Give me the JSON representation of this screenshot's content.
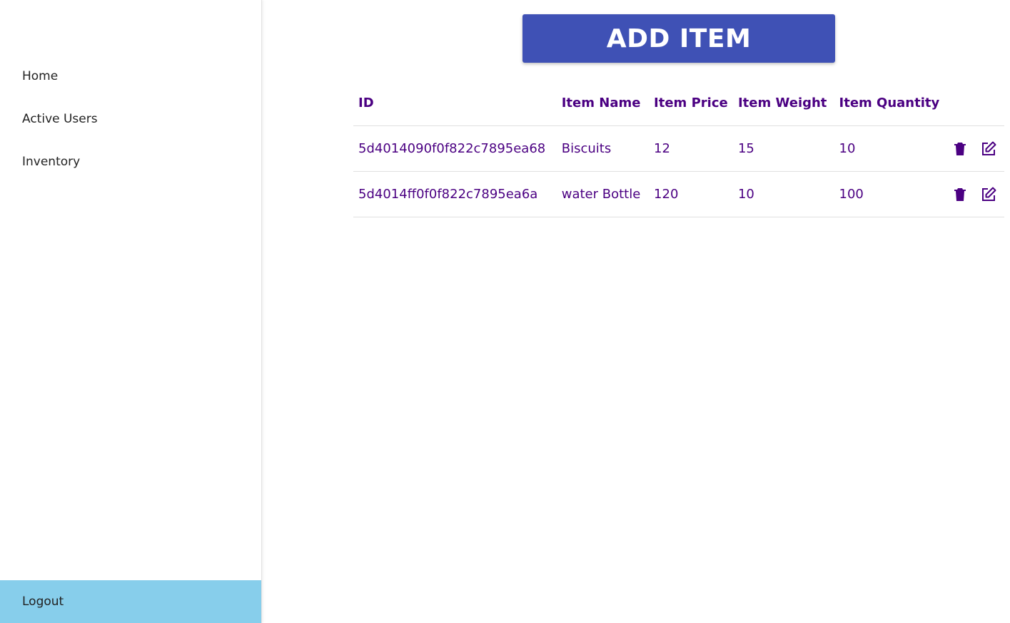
{
  "colors": {
    "accent": "#3f51b5",
    "text_purple": "#4b0082",
    "logout_bg": "#87ceeb",
    "nav_text": "#222222"
  },
  "sidebar": {
    "items": [
      {
        "label": "Home"
      },
      {
        "label": "Active Users"
      },
      {
        "label": "Inventory"
      }
    ],
    "logout_label": "Logout"
  },
  "main": {
    "add_button_label": "ADD ITEM",
    "table": {
      "headers": [
        "ID",
        "Item Name",
        "Item Price",
        "Item Weight",
        "Item Quantity"
      ],
      "rows": [
        {
          "id": "5d4014090f0f822c7895ea68",
          "name": "Biscuits",
          "price": "12",
          "weight": "15",
          "quantity": "10"
        },
        {
          "id": "5d4014ff0f0f822c7895ea6a",
          "name": "water Bottle",
          "price": "120",
          "weight": "10",
          "quantity": "100"
        }
      ],
      "row_actions": [
        "trash-icon",
        "edit-icon"
      ]
    }
  }
}
